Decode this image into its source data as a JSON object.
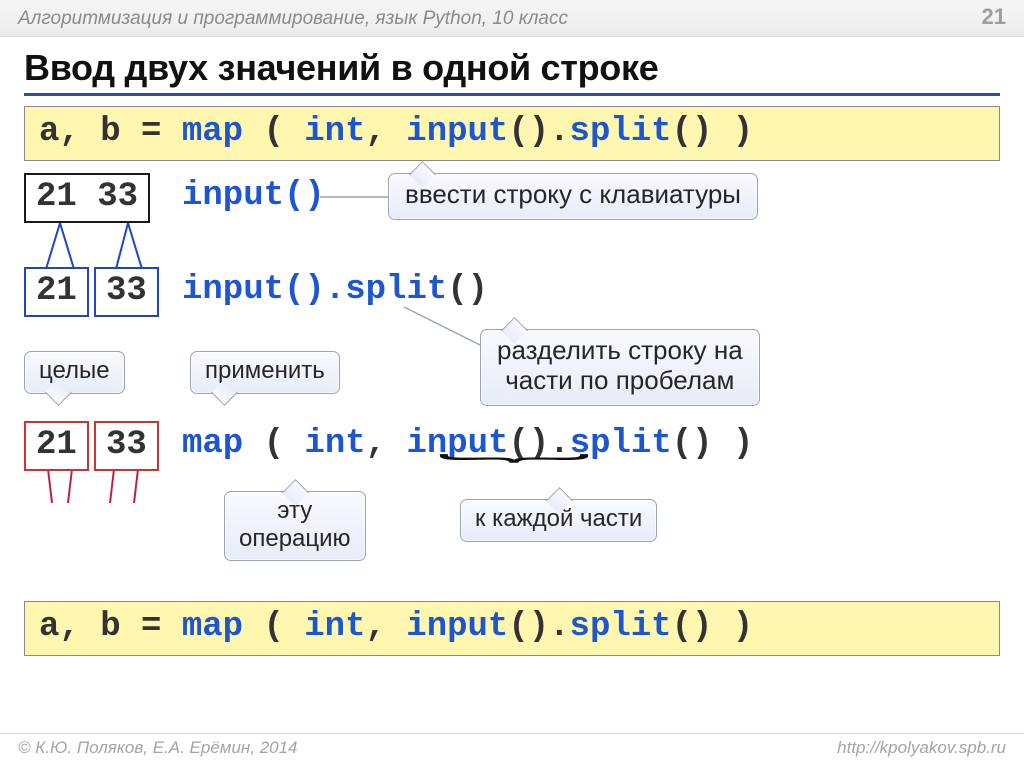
{
  "header": {
    "subject": "Алгоритмизация и программирование, язык Python, 10 класс",
    "page_number": "21"
  },
  "title": "Ввод двух значений в одной строке",
  "code_top": {
    "prefix": "a, b = ",
    "kw1": "map",
    "mid1": " ( ",
    "kw2": "int",
    "mid2": ", ",
    "kw3": "input",
    "mid3": "().",
    "kw4": "split",
    "suffix": "() )"
  },
  "row_input": {
    "box_text": "21 33",
    "call": "input()",
    "callout": "ввести строку с клавиатуры"
  },
  "row_split": {
    "box_a": "21",
    "box_b": "33",
    "call_prefix": "input().",
    "call_kw": "split",
    "call_suffix": "()",
    "callout": "разделить строку на\nчасти по пробелам"
  },
  "labels": {
    "integers": "целые",
    "apply": "применить",
    "this_op": "эту\nоперацию",
    "to_each": "к каждой части"
  },
  "row_map": {
    "box_a": "21",
    "box_b": "33",
    "call_kw1": "map",
    "mid1": " ( ",
    "call_kw2": "int",
    "mid2": ", ",
    "call_kw3": "input",
    "mid3": "().",
    "call_kw4": "split",
    "suffix": "() )"
  },
  "code_bottom": {
    "prefix": "a, b = ",
    "kw1": "map",
    "mid1": " ( ",
    "kw2": "int",
    "mid2": ", ",
    "kw3": "input",
    "mid3": "().",
    "kw4": "split",
    "suffix": "() )"
  },
  "footer": {
    "left": "© К.Ю. Поляков, Е.А. Ерёмин, 2014",
    "right": "http://kpolyakov.spb.ru"
  }
}
